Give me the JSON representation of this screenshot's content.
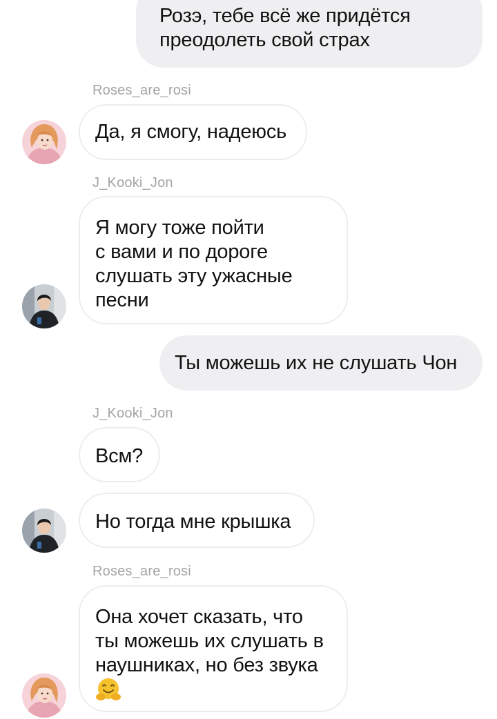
{
  "messages": [
    {
      "direction": "outgoing",
      "lines": [
        "Розэ, тебе всё же придётся",
        "преодолеть свой страх"
      ]
    },
    {
      "direction": "incoming",
      "sender": "Roses_are_rosi",
      "lines": [
        "Да, я смогу, надеюсь"
      ],
      "avatar": "rose-avatar"
    },
    {
      "direction": "incoming",
      "sender": "J_Kooki_Jon",
      "lines": [
        "Я могу тоже пойти",
        "с вами и по дороге",
        "слушать эту ужасные",
        "песни"
      ],
      "avatar": "jon-avatar"
    },
    {
      "direction": "outgoing",
      "lines": [
        "Ты можешь их не слушать Чон"
      ]
    },
    {
      "direction": "incoming",
      "sender": "J_Kooki_Jon",
      "lines": [
        "Всм?"
      ]
    },
    {
      "direction": "incoming",
      "lines": [
        "Но тогда мне крышка"
      ],
      "avatar": "jon-avatar"
    },
    {
      "direction": "incoming",
      "sender": "Roses_are_rosi",
      "lines": [
        "Она хочет сказать, что",
        "ты можешь их слушать в",
        "наушниках, но без звука"
      ],
      "emoji": "hugging-face-emoji",
      "avatar": "rose-avatar"
    }
  ],
  "colors": {
    "outgoing_bubble": "#efeff1",
    "incoming_border": "#ededef",
    "sender_text": "#a4a4a8",
    "message_text": "#111111"
  }
}
